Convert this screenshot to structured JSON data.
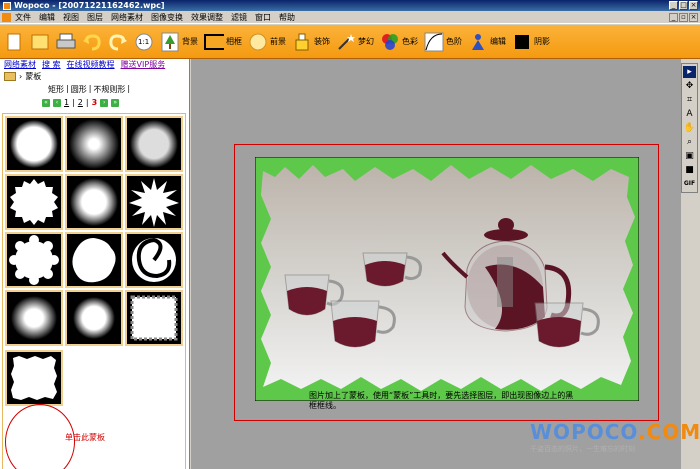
{
  "window": {
    "title": "Wopoco - [20071221162462.wpc]"
  },
  "menu": {
    "items": [
      "文件",
      "编辑",
      "视图",
      "图层",
      "网络素材",
      "图像变换",
      "效果调整",
      "滤镜",
      "窗口",
      "帮助"
    ]
  },
  "toolbar": {
    "background": "背景",
    "frame": "相框",
    "foreground": "前景",
    "decoration": "装饰",
    "dream": "梦幻",
    "color": "色彩",
    "tone": "色阶",
    "edit": "编辑",
    "shadow": "阴影",
    "zoom": "1:1"
  },
  "links": {
    "web_material": "网络素材",
    "search": "搜 索",
    "video_tutorial": "在线视频教程",
    "vip_service": "赠送VIP服务"
  },
  "breadcrumb": {
    "label": "蒙板"
  },
  "mask_tabs": {
    "rect": "矩形",
    "circle": "圆形",
    "irregular": "不规则形"
  },
  "pager": {
    "pages": [
      "1",
      "2",
      "3"
    ],
    "current": "3"
  },
  "grid": {
    "click_note": "单击此蒙板"
  },
  "canvas": {
    "caption": "图片加上了蒙板，使用“蒙板”工具时，要先选择图层，即出现图像边上的黑框框线。"
  },
  "watermark": {
    "brand_a": "WOPOCO",
    "brand_b": ".COM",
    "sub": "千姿百态的照片，一生难忘的时刻"
  },
  "tools": {
    "gif": "GIF"
  },
  "colors": {
    "toolbar": "#f59a10",
    "accent_red": "#d00000",
    "link": "#0000cc",
    "green_mask": "#5ec84a"
  }
}
